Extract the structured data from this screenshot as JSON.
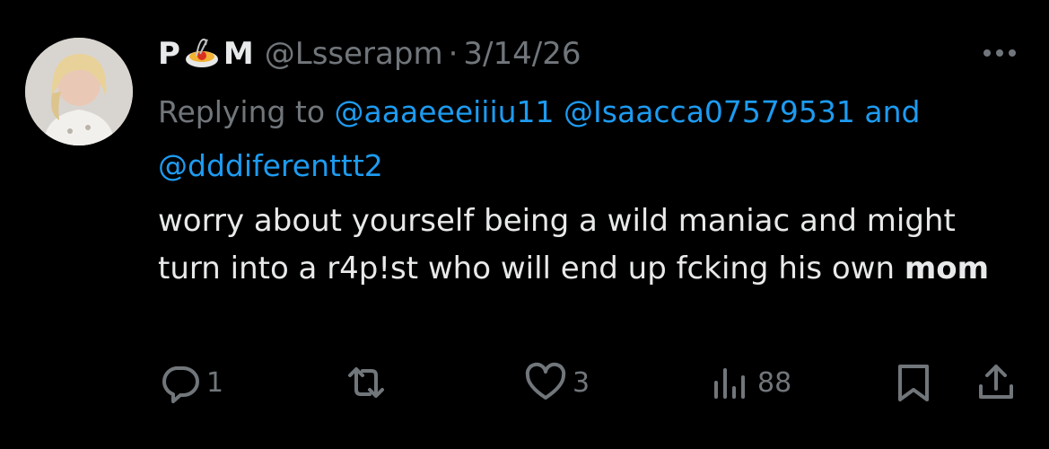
{
  "tweet": {
    "display_name_start": "P",
    "display_name_end": "M",
    "handle": "@Lsserapm",
    "separator": "·",
    "date": "3/14/26",
    "replying_prefix": "Replying to",
    "mentions": [
      "@aaaeeeiiiu11",
      "@Isaacca07579531"
    ],
    "mention_conjunction": "and",
    "mention_last": "@dddiferenttt2",
    "body_plain": "worry about yourself being a wild maniac and might turn into a r4p!st who will end up fcking his own",
    "body_bold": "mom"
  },
  "actions": {
    "reply_count": "1",
    "like_count": "3",
    "views_count": "88"
  },
  "icons": {
    "emoji": "spaghetti-emoji",
    "more": "more-horizontal-icon",
    "reply": "reply-icon",
    "retweet": "retweet-icon",
    "like": "heart-icon",
    "views": "views-icon",
    "bookmark": "bookmark-icon",
    "share": "share-icon"
  },
  "colors": {
    "background": "#000000",
    "text": "#e7e9ea",
    "muted": "#71767b",
    "link": "#1d9bf0"
  }
}
